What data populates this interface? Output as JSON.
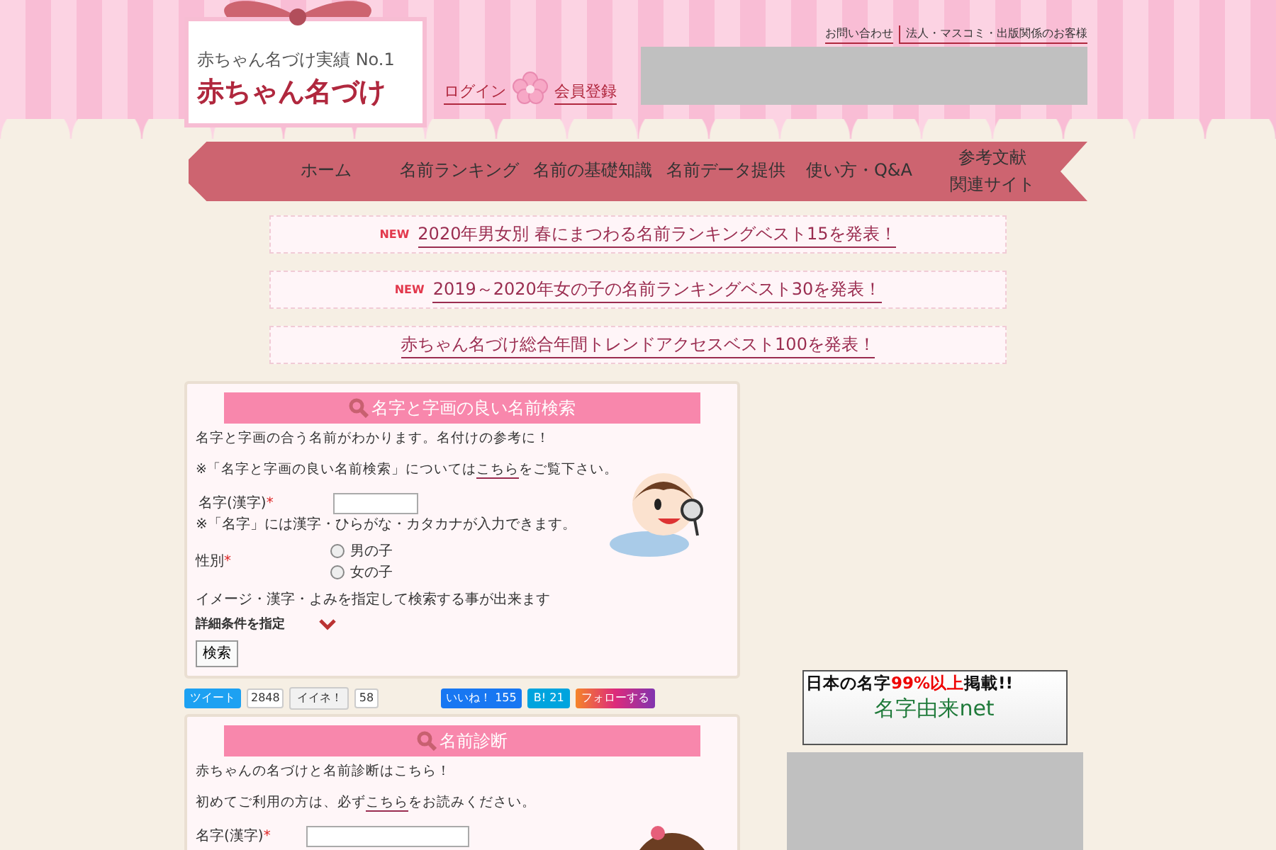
{
  "header": {
    "tagline": "赤ちゃん名づけ実績 No.1",
    "logo": "赤ちゃん名づけ",
    "login": "ログイン",
    "register": "会員登録",
    "top_links": [
      "お問い合わせ",
      "法人・マスコミ・出版関係のお客様"
    ]
  },
  "nav": {
    "items": [
      {
        "label": "ホーム"
      },
      {
        "label": "名前ランキング"
      },
      {
        "label": "名前の基礎知識"
      },
      {
        "label": "名前データ提供"
      },
      {
        "label": "使い方・Q&A"
      },
      {
        "lines": [
          "参考文献",
          "関連サイト"
        ]
      }
    ]
  },
  "notices": [
    {
      "badge": "NEW",
      "text": "2020年男女別 春にまつわる名前ランキングベスト15を発表！"
    },
    {
      "badge": "NEW",
      "text": "2019～2020年女の子の名前ランキングベスト30を発表！"
    },
    {
      "text": "赤ちゃん名づけ総合年間トレンドアクセスベスト100を発表！"
    }
  ],
  "search_panel": {
    "title": "名字と字画の良い名前検索",
    "intro": "名字と字画の合う名前がわかります。名付けの参考に！",
    "note_before": "※「名字と字画の良い名前検索」については",
    "note_link": "こちら",
    "note_after": "をご覧下さい。",
    "surname_label": "名字(漢字)",
    "required": "*",
    "surname_hint": "※「名字」には漢字・ひらがな・カタカナが入力できます。",
    "gender_label": "性別",
    "genders": [
      {
        "label": "男の子",
        "selected": false
      },
      {
        "label": "女の子",
        "selected": false
      }
    ],
    "detail_note": "イメージ・漢字・よみを指定して検索する事が出来ます",
    "detail_toggle": "詳細条件を指定",
    "expanded": false,
    "submit": "検索"
  },
  "social": [
    {
      "kind": "tweet",
      "label": "ツイート",
      "count": "2848"
    },
    {
      "kind": "mixi",
      "label": "イイネ！",
      "count": "58"
    },
    {
      "kind": "fb",
      "label": "いいね！ 155"
    },
    {
      "kind": "hatena",
      "label": "B! 21"
    },
    {
      "kind": "insta",
      "label": "フォローする"
    }
  ],
  "diagnosis_panel": {
    "title": "名前診断",
    "intro": "赤ちゃんの名づけと名前診断はこちら！",
    "note_before": "初めてご利用の方は、必ず",
    "note_link": "こちら",
    "note_after": "をお読みください。",
    "surname_label": "名字(漢字)",
    "required": "*"
  },
  "banner": {
    "headline_before": "日本の名字",
    "headline_highlight": "99%以上",
    "headline_after": "掲載!!",
    "brand": "名字由来net"
  }
}
